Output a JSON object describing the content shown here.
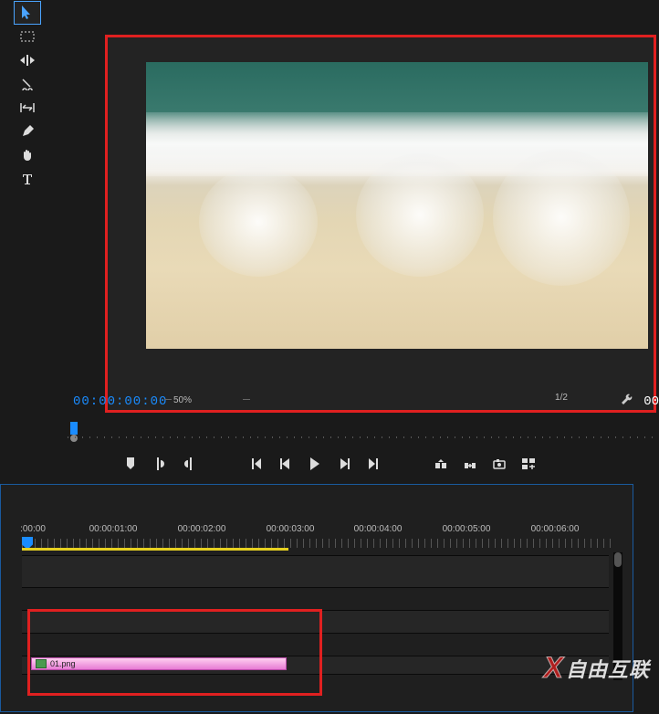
{
  "tools": {
    "selection": "selection-tool",
    "track_select": "track-select-tool",
    "ripple": "ripple-edit-tool",
    "razor": "razor-tool",
    "slip": "slip-tool",
    "pen": "pen-tool",
    "hand": "hand-tool",
    "type": "type-tool"
  },
  "program": {
    "timecode_in": "00:00:00:00",
    "timecode_out": "00",
    "zoom_level": "50%",
    "resolution": "1/2"
  },
  "timeline": {
    "ruler": [
      ":00:00",
      "00:00:01:00",
      "00:00:02:00",
      "00:00:03:00",
      "00:00:04:00",
      "00:00:05:00",
      "00:00:06:00"
    ],
    "clip_name": "01.png"
  },
  "watermark": "自由互联"
}
